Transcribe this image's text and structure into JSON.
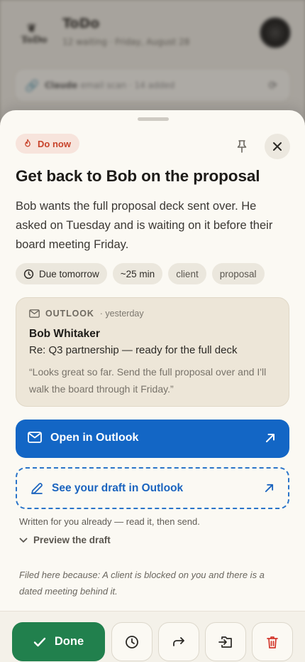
{
  "background": {
    "app_title": "ToDo",
    "app_subtitle": "12 waiting · Friday, August 28",
    "logo_text": "ToDo",
    "bar_label": "Claude",
    "bar_detail": "email scan · 14 added"
  },
  "sheet": {
    "priority_badge": "Do now",
    "title": "Get back to Bob on the proposal",
    "description": "Bob wants the full proposal deck sent over. He asked on Tuesday and is waiting on it before their board meeting Friday.",
    "chips": {
      "due": "Due tomorrow",
      "effort": "~25 min",
      "tag1": "client",
      "tag2": "proposal"
    },
    "source_card": {
      "source": "OUTLOOK",
      "time": "· yesterday",
      "sender": "Bob Whitaker",
      "subject": "Re: Q3 partnership — ready for the full deck",
      "quote": "“Looks great so far. Send the full proposal over and I'll walk the board through it Friday.”"
    },
    "open_button": "Open in Outlook",
    "draft_button": "See your draft in Outlook",
    "draft_note": "Written for you already — read it, then send.",
    "preview_toggle": "Preview the draft",
    "reason": "Filed here because: A client is blocked on you and there is a dated meeting behind it."
  },
  "actions": {
    "done_label": "Done"
  },
  "colors": {
    "accent_blue": "#1366c5",
    "done_green": "#21804d",
    "priority_red": "#c8432b",
    "sheet_bg": "#fbf9f3"
  },
  "icons": [
    "flame-icon",
    "pin-icon",
    "close-icon",
    "clock-icon",
    "mail-icon",
    "external-arrow-icon",
    "pencil-icon",
    "chevron-down-icon",
    "check-icon",
    "snooze-clock-icon",
    "forward-icon",
    "move-icon",
    "trash-icon"
  ]
}
